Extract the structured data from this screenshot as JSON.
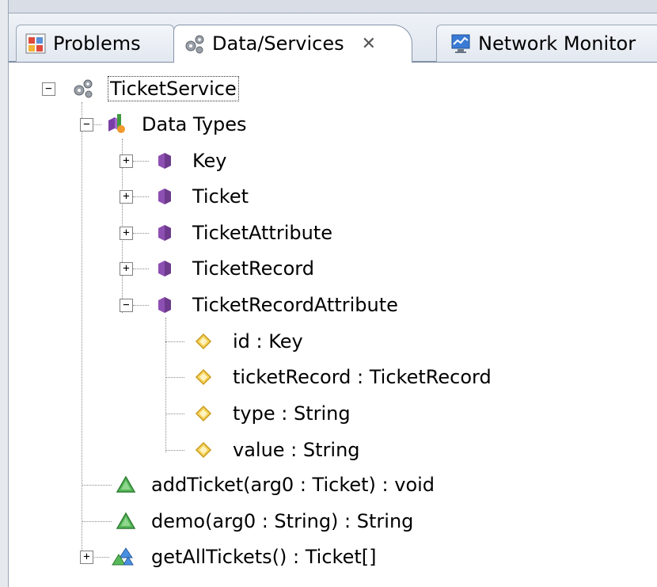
{
  "tabs": [
    {
      "label": "Problems",
      "icon": "problems-icon",
      "active": false
    },
    {
      "label": "Data/Services",
      "icon": "gears-icon",
      "active": true,
      "close": "close-icon"
    },
    {
      "label": "Network Monitor",
      "icon": "network-monitor-icon",
      "active": false
    }
  ],
  "tree": {
    "root": {
      "label": "TicketService",
      "icon": "gears-icon",
      "expanded": true
    },
    "data_types": {
      "label": "Data Types",
      "icon": "data-types-icon",
      "expanded": true
    },
    "types": [
      {
        "label": "Key",
        "expanded": false
      },
      {
        "label": "Ticket",
        "expanded": false
      },
      {
        "label": "TicketAttribute",
        "expanded": false
      },
      {
        "label": "TicketRecord",
        "expanded": false
      },
      {
        "label": "TicketRecordAttribute",
        "expanded": true
      }
    ],
    "properties": [
      {
        "label": "id : Key"
      },
      {
        "label": "ticketRecord : TicketRecord"
      },
      {
        "label": "type : String"
      },
      {
        "label": "value : String"
      }
    ],
    "operations": [
      {
        "label": "addTicket(arg0 : Ticket) : void",
        "icon": "operation-triangle-icon"
      },
      {
        "label": "demo(arg0 : String) : String",
        "icon": "operation-triangle-icon"
      },
      {
        "label": "getAllTickets() : Ticket[]",
        "icon": "operation-multi-icon",
        "expanded": false
      }
    ]
  },
  "colors": {
    "type_purple": "#8e4fb3",
    "property_yellow": "#f2c63a",
    "operation_green": "#4caf50",
    "gear_gray": "#8a8f98"
  }
}
